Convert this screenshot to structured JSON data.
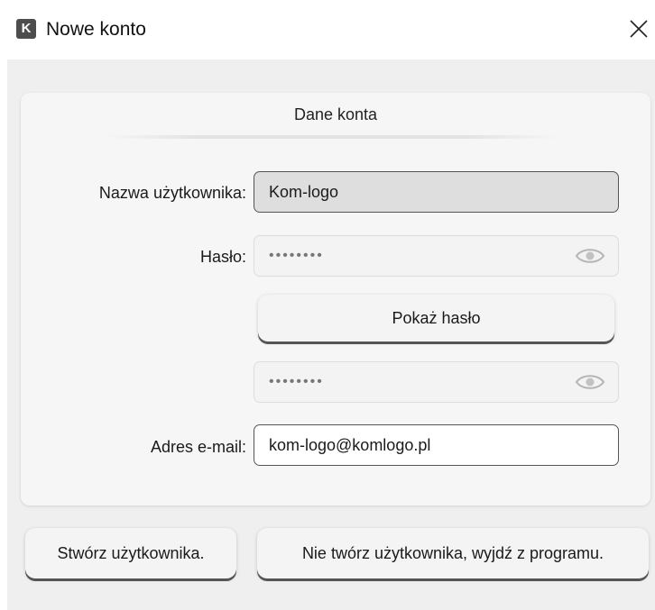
{
  "window": {
    "icon_letter": "K",
    "title": "Nowe konto"
  },
  "form": {
    "section_title": "Dane konta",
    "username": {
      "label": "Nazwa użytkownika:",
      "value": "Kom-logo"
    },
    "password": {
      "label": "Hasło:",
      "value": "••••••••"
    },
    "show_password_label": "Pokaż hasło",
    "password_confirm": {
      "value": "••••••••"
    },
    "email": {
      "label": "Adres e-mail:",
      "value": "kom-logo@komlogo.pl"
    }
  },
  "actions": {
    "create_label": "Stwórz użytkownika.",
    "exit_label": "Nie twórz użytkownika, wyjdź z programu."
  },
  "colors": {
    "disabled_field_bg": "#dedede",
    "panel_bg": "#f6f6f6",
    "client_bg": "#efefef",
    "app_icon_bg": "#4d4d4d"
  }
}
